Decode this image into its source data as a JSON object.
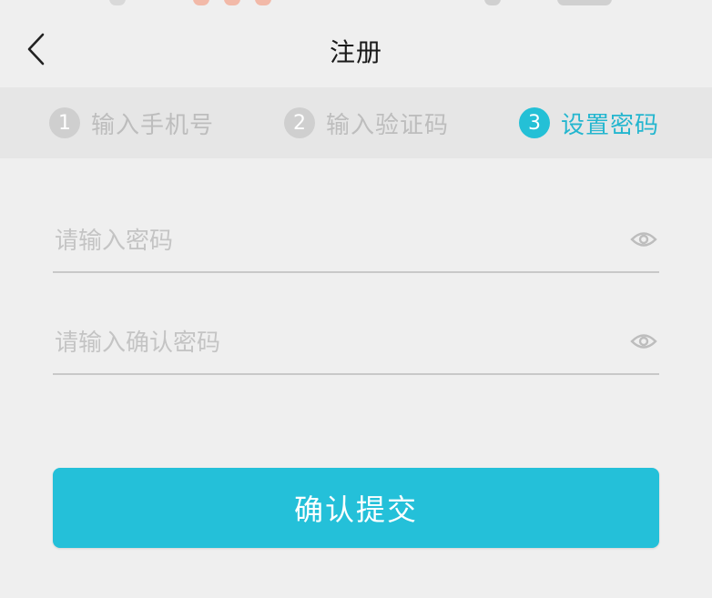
{
  "header": {
    "title": "注册",
    "back_icon": "chevron-left-icon"
  },
  "steps": [
    {
      "number": "1",
      "label": "输入手机号",
      "active": false
    },
    {
      "number": "2",
      "label": "输入验证码",
      "active": false
    },
    {
      "number": "3",
      "label": "设置密码",
      "active": true
    }
  ],
  "form": {
    "password": {
      "placeholder": "请输入密码",
      "value": "",
      "icon": "eye-icon"
    },
    "confirm_password": {
      "placeholder": "请输入确认密码",
      "value": "",
      "icon": "eye-icon"
    },
    "submit_label": "确认提交"
  },
  "colors": {
    "accent": "#24c0d9",
    "inactive_step": "#cfcfcf",
    "background": "#efefef",
    "steps_bar_bg": "#e6e6e6"
  }
}
